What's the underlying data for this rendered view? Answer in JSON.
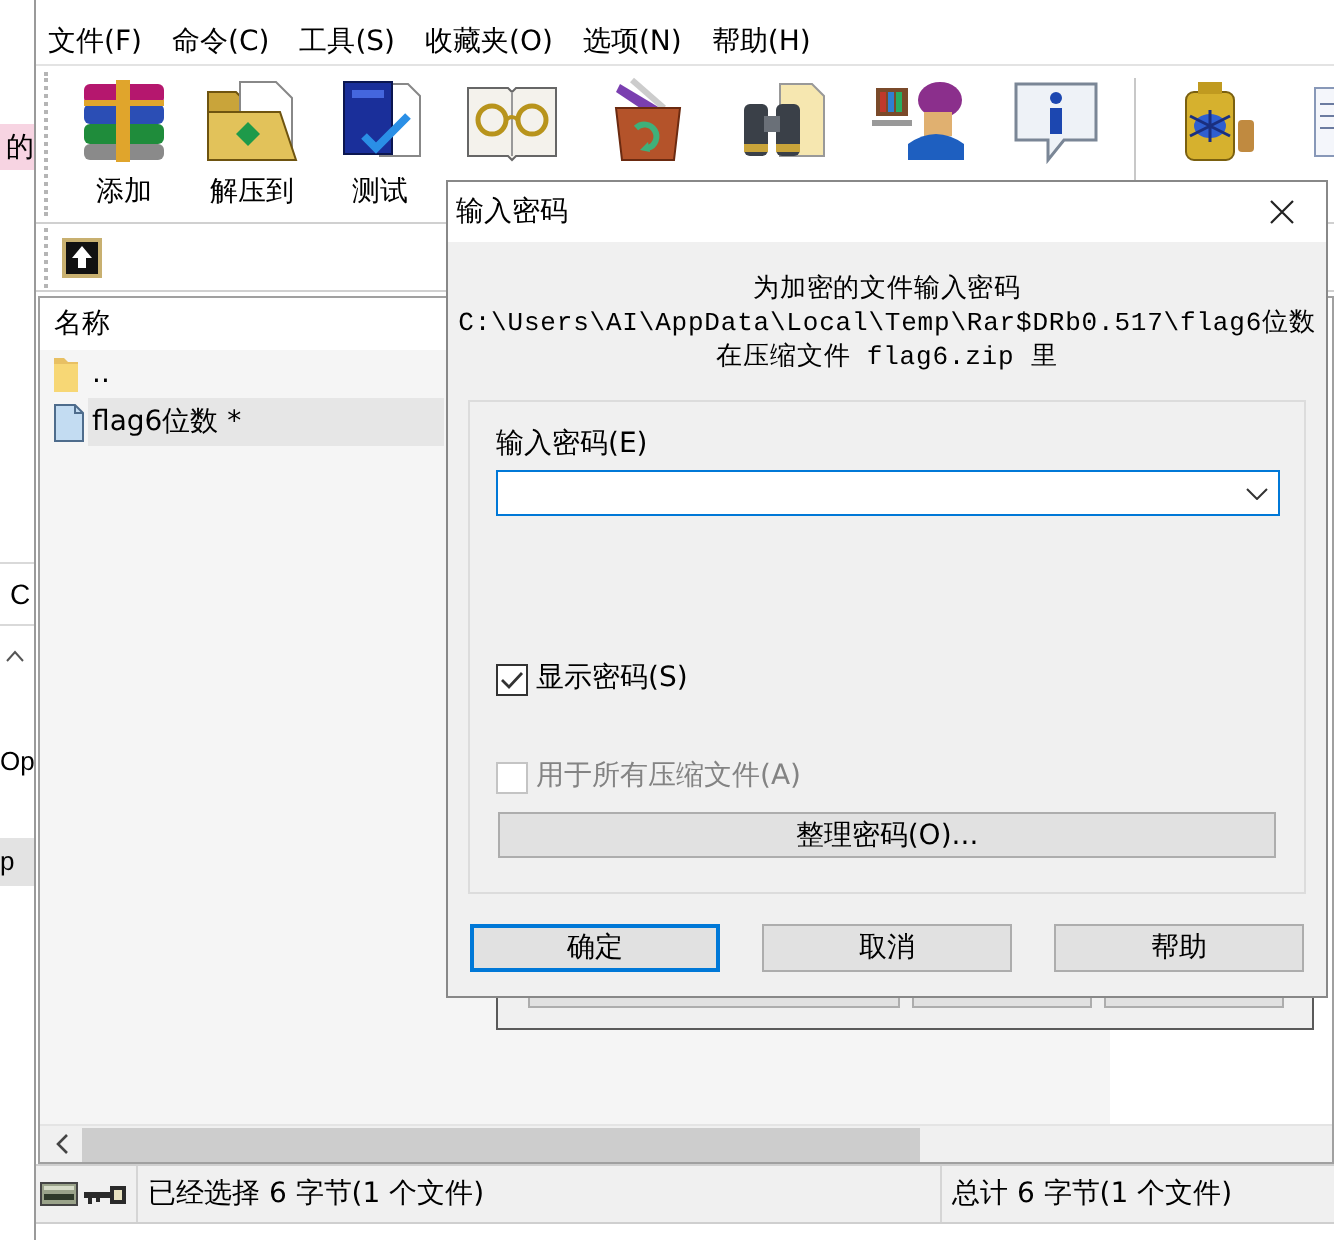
{
  "side_fragments": [
    {
      "kind": "tag",
      "text": "的",
      "selected": false
    },
    {
      "kind": "header",
      "text": "C",
      "selected": false
    },
    {
      "kind": "item",
      "text": "Op",
      "selected": false
    },
    {
      "kind": "item",
      "text": "p",
      "selected": true
    }
  ],
  "menu": [
    "文件(F)",
    "命令(C)",
    "工具(S)",
    "收藏夹(O)",
    "选项(N)",
    "帮助(H)"
  ],
  "toolbar": [
    {
      "label": "添加"
    },
    {
      "label": "解压到"
    },
    {
      "label": "测试"
    }
  ],
  "file_list": {
    "columns": [
      "名称"
    ],
    "rows": [
      {
        "kind": "folder",
        "name": "..",
        "selected": false
      },
      {
        "kind": "file",
        "name": "flag6位数 *",
        "selected": true
      }
    ]
  },
  "status_bar": {
    "selection": "已经选择 6 字节(1 个文件)",
    "total": "总计 6 字节(1 个文件)"
  },
  "dialog": {
    "title": "输入密码",
    "message": [
      "为加密的文件输入密码",
      "C:\\Users\\AI\\AppData\\Local\\Temp\\Rar$DRb0.517\\flag6位数",
      "在压缩文件 flag6.zip 里"
    ],
    "password_label": "输入密码(E)",
    "options": [
      {
        "label": "显示密码(S)",
        "checked": true,
        "disabled": false
      },
      {
        "label": "用于所有压缩文件(A)",
        "checked": false,
        "disabled": true
      }
    ],
    "organize_button": "整理密码(O)...",
    "buttons": [
      {
        "label": "确定",
        "default": true
      },
      {
        "label": "取消",
        "default": false
      },
      {
        "label": "帮助",
        "default": false
      }
    ]
  }
}
